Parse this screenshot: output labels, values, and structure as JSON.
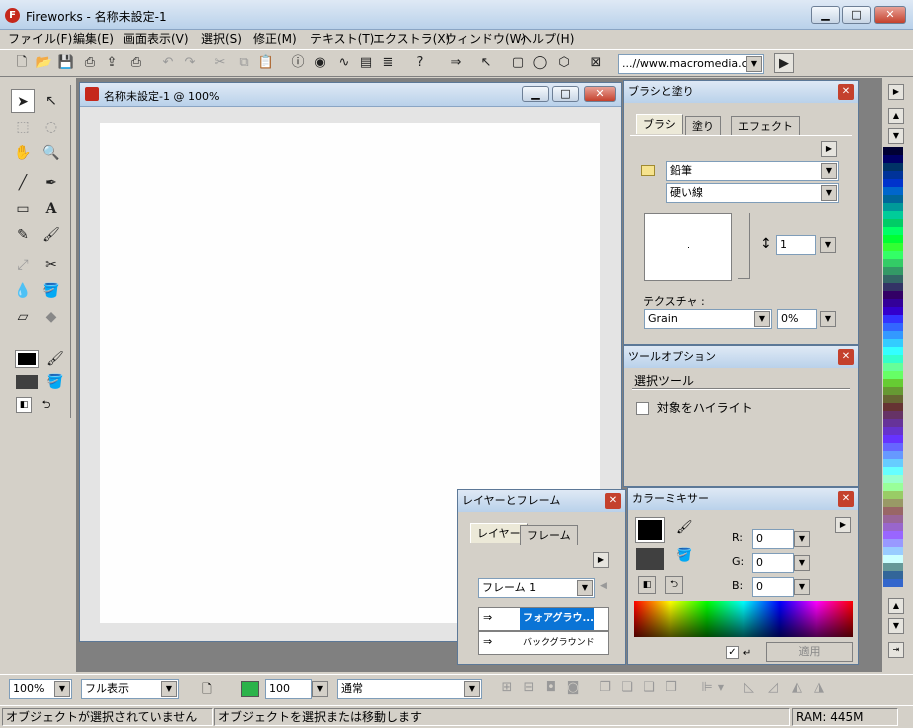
{
  "window": {
    "title": "Fireworks - 名称未設定-1",
    "app_icon": "fireworks-logo"
  },
  "menu": [
    "ファイル(F)",
    "編集(E)",
    "画面表示(V)",
    "選択(S)",
    "修正(M)",
    "テキスト(T)",
    "エクストラ(X)",
    "ウィンドウ(W)",
    "ヘルプ(H)"
  ],
  "toolbar": {
    "url": "...//www.macromedia.c"
  },
  "document": {
    "title": "名称未設定-1 @ 100%"
  },
  "brush_panel": {
    "title": "ブラシと塗り",
    "tabs": [
      "ブラシ",
      "塗り",
      "エフェクト"
    ],
    "category": "鉛筆",
    "type": "硬い線",
    "size": "1",
    "texture_label": "テクスチャ :",
    "texture": "Grain",
    "texture_amount": "0%"
  },
  "tool_options": {
    "title": "ツールオプション",
    "tool_name": "選択ツール",
    "highlight_label": "対象をハイライト"
  },
  "layers_panel": {
    "title": "レイヤーとフレーム",
    "tabs": [
      "レイヤー",
      "フレーム"
    ],
    "frame": "フレーム 1",
    "layers": [
      "フォアグラウ...",
      "バックグラウンド"
    ]
  },
  "color_mixer": {
    "title": "カラーミキサー",
    "r_label": "R:",
    "r": "0",
    "g_label": "G:",
    "g": "0",
    "b_label": "B:",
    "b": "0",
    "apply": "適用"
  },
  "bottom": {
    "zoom": "100%",
    "view": "フル表示",
    "opacity": "100",
    "blend": "通常"
  },
  "status": {
    "left": "オブジェクトが選択されていません",
    "hint": "オブジェクトを選択または移動します",
    "ram": "RAM: 445M"
  },
  "colors": {
    "title_grad": "#b9d1ea",
    "close_red": "#c4412d",
    "selected_layer": "#0a74d6"
  }
}
